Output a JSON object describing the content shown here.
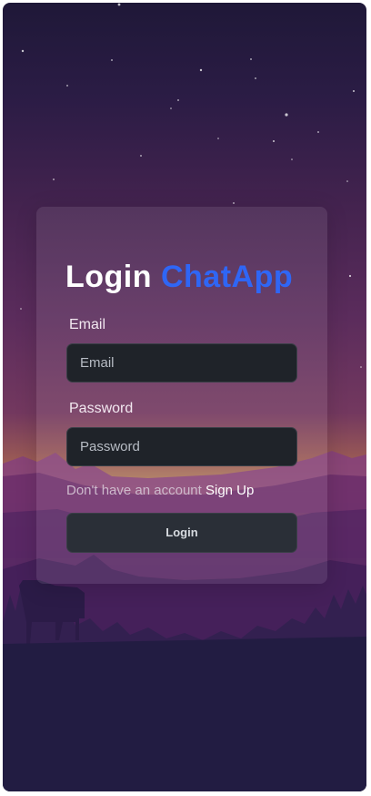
{
  "login": {
    "title_prefix": "Login",
    "title_brand": "ChatApp",
    "email_label": "Email",
    "email_placeholder": "Email",
    "password_label": "Password",
    "password_placeholder": "Password",
    "signup_prompt": "Don't have an account",
    "signup_link": "Sign Up",
    "submit_label": "Login"
  },
  "colors": {
    "brand_accent": "#2f66f5",
    "input_background": "#1f2329",
    "button_background": "#2a2f37"
  }
}
